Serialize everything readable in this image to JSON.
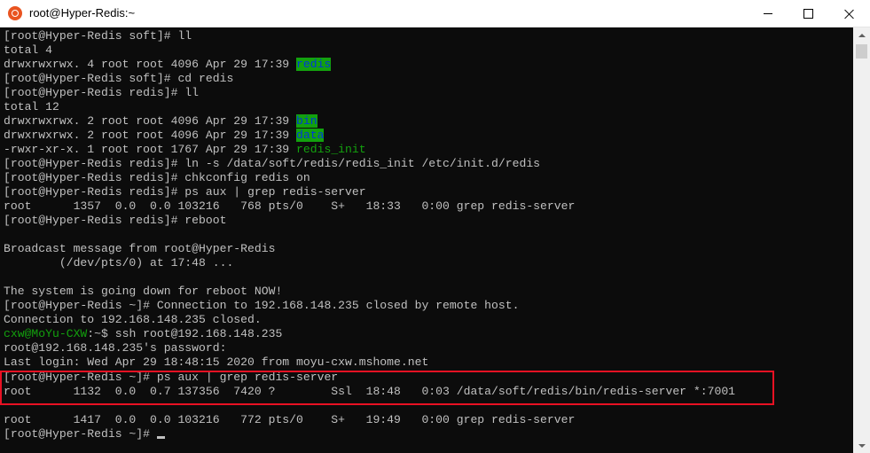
{
  "window": {
    "title": "root@Hyper-Redis:~",
    "controls": {
      "minimize": "minimize",
      "maximize": "maximize",
      "close": "close"
    }
  },
  "terminal": {
    "lines": [
      {
        "parts": [
          {
            "t": "[root@Hyper-Redis soft]# ll"
          }
        ]
      },
      {
        "parts": [
          {
            "t": "total 4"
          }
        ]
      },
      {
        "parts": [
          {
            "t": "drwxrwxrwx. 4 root root 4096 Apr 29 17:39 "
          },
          {
            "t": "redis",
            "c": "hl-green"
          }
        ]
      },
      {
        "parts": [
          {
            "t": "[root@Hyper-Redis soft]# cd redis"
          }
        ]
      },
      {
        "parts": [
          {
            "t": "[root@Hyper-Redis redis]# ll"
          }
        ]
      },
      {
        "parts": [
          {
            "t": "total 12"
          }
        ]
      },
      {
        "parts": [
          {
            "t": "drwxrwxrwx. 2 root root 4096 Apr 29 17:39 "
          },
          {
            "t": "bin",
            "c": "hl-green"
          }
        ]
      },
      {
        "parts": [
          {
            "t": "drwxrwxrwx. 2 root root 4096 Apr 29 17:39 "
          },
          {
            "t": "data",
            "c": "hl-green"
          }
        ]
      },
      {
        "parts": [
          {
            "t": "-rwxr-xr-x. 1 root root 1767 Apr 29 17:39 "
          },
          {
            "t": "redis_init",
            "c": "green"
          }
        ]
      },
      {
        "parts": [
          {
            "t": "[root@Hyper-Redis redis]# ln -s /data/soft/redis/redis_init /etc/init.d/redis"
          }
        ]
      },
      {
        "parts": [
          {
            "t": "[root@Hyper-Redis redis]# chkconfig redis on"
          }
        ]
      },
      {
        "parts": [
          {
            "t": "[root@Hyper-Redis redis]# ps aux | grep redis-server"
          }
        ]
      },
      {
        "parts": [
          {
            "t": "root      1357  0.0  0.0 103216   768 pts/0    S+   18:33   0:00 grep redis-server"
          }
        ]
      },
      {
        "parts": [
          {
            "t": "[root@Hyper-Redis redis]# reboot"
          }
        ]
      },
      {
        "parts": [
          {
            "t": ""
          }
        ]
      },
      {
        "parts": [
          {
            "t": "Broadcast message from root@Hyper-Redis"
          }
        ]
      },
      {
        "parts": [
          {
            "t": "        (/dev/pts/0) at 17:48 ..."
          }
        ]
      },
      {
        "parts": [
          {
            "t": ""
          }
        ]
      },
      {
        "parts": [
          {
            "t": "The system is going down for reboot NOW!"
          }
        ]
      },
      {
        "parts": [
          {
            "t": "[root@Hyper-Redis ~]# Connection to 192.168.148.235 closed by remote host."
          }
        ]
      },
      {
        "parts": [
          {
            "t": "Connection to 192.168.148.235 closed."
          }
        ]
      },
      {
        "parts": [
          {
            "t": "cxw@MoYu-CXW",
            "c": "green"
          },
          {
            "t": ":~$ ssh root@192.168.148.235"
          }
        ]
      },
      {
        "parts": [
          {
            "t": "root@192.168.148.235's password:"
          }
        ]
      },
      {
        "parts": [
          {
            "t": "Last login: Wed Apr 29 18:48:15 2020 from moyu-cxw.mshome.net"
          }
        ]
      },
      {
        "parts": [
          {
            "t": "[root@Hyper-Redis ~]# ps aux | grep redis-server"
          }
        ]
      },
      {
        "parts": [
          {
            "t": "root      1132  0.0  0.7 137356  7420 ?        Ssl  18:48   0:03 /data/soft/redis/bin/redis-server *:7001"
          }
        ]
      },
      {
        "parts": [
          {
            "t": ""
          }
        ]
      },
      {
        "parts": [
          {
            "t": "root      1417  0.0  0.0 103216   772 pts/0    S+   19:49   0:00 grep redis-server"
          }
        ]
      },
      {
        "parts": [
          {
            "t": "[root@Hyper-Redis ~]# "
          }
        ],
        "cursor": true
      }
    ]
  }
}
